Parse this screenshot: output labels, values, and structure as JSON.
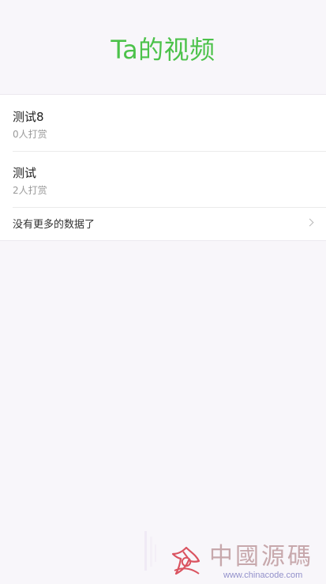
{
  "header": {
    "title": "Ta的视频"
  },
  "items": [
    {
      "title": "测试8",
      "sub": "0人打赏"
    },
    {
      "title": "测试",
      "sub": "2人打赏"
    }
  ],
  "more": {
    "label": "没有更多的数据了"
  },
  "watermark": {
    "name": "中國源碼",
    "url": "www.chinacode.com"
  },
  "colors": {
    "accent": "#4cc24a",
    "background": "#f8f6fa",
    "surface": "#ffffff",
    "text": "#222222",
    "subtext": "#9a9a9a",
    "watermark_red": "#d94b58",
    "watermark_text": "#c5a4a8",
    "watermark_url": "#8d8bc8"
  },
  "icons": {
    "more": "chevron-right-icon",
    "watermark": "watermark-logo-icon"
  }
}
